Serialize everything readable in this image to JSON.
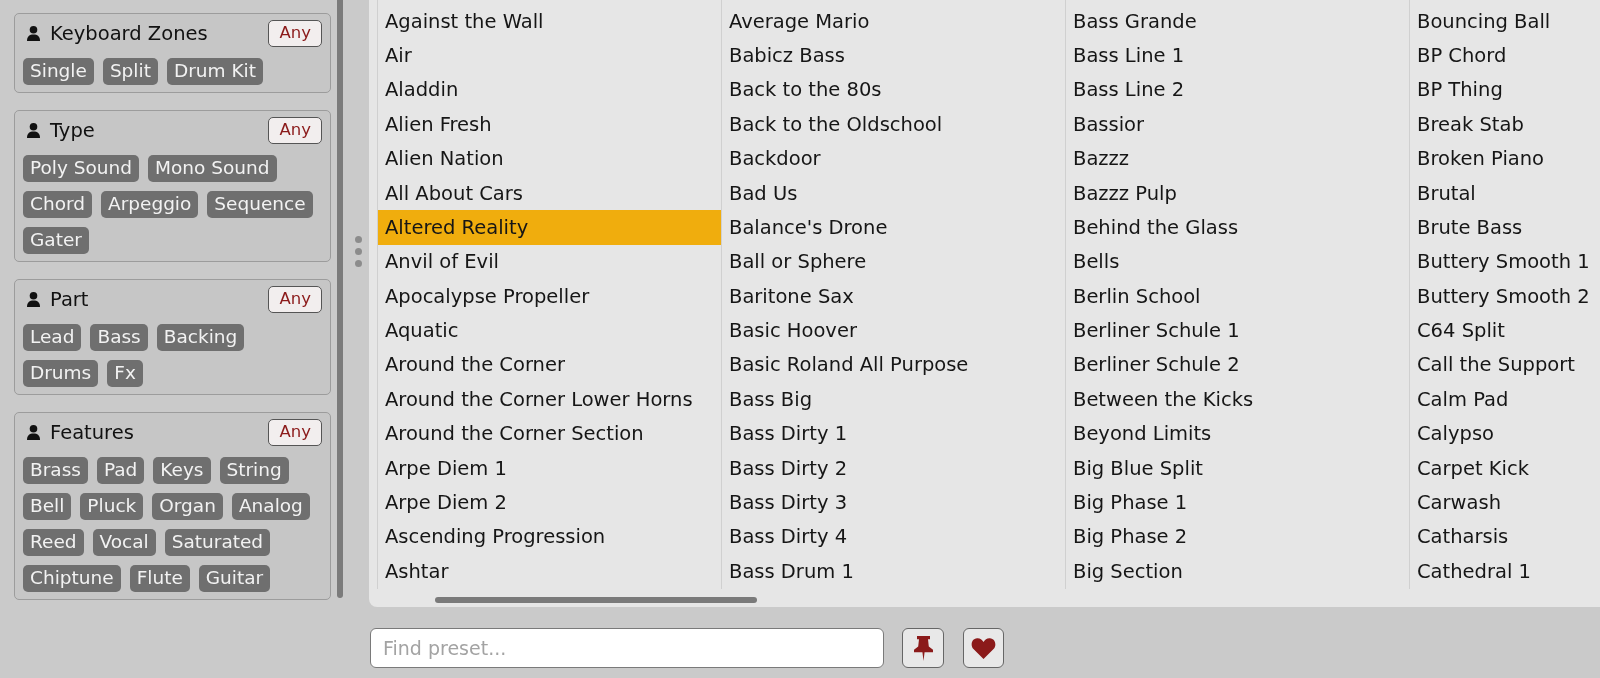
{
  "filters": [
    {
      "title": "Keyboard Zones",
      "any_button": "Any",
      "tags": [
        {
          "label": "Single",
          "selected": false
        },
        {
          "label": "Split",
          "selected": false
        },
        {
          "label": "Drum Kit",
          "selected": false
        }
      ]
    },
    {
      "title": "Type",
      "any_button": "Any",
      "tags": [
        {
          "label": "Poly Sound",
          "selected": false
        },
        {
          "label": "Mono Sound",
          "selected": false
        },
        {
          "label": "Chord",
          "selected": false
        },
        {
          "label": "Arpeggio",
          "selected": false
        },
        {
          "label": "Sequence",
          "selected": false
        },
        {
          "label": "Gater",
          "selected": false
        }
      ]
    },
    {
      "title": "Part",
      "any_button": "Any",
      "tags": [
        {
          "label": "Lead",
          "selected": false
        },
        {
          "label": "Bass",
          "selected": false
        },
        {
          "label": "Backing",
          "selected": false
        },
        {
          "label": "Drums",
          "selected": false
        },
        {
          "label": "Fx",
          "selected": false
        }
      ]
    },
    {
      "title": "Features",
      "any_button": "Any",
      "tags": [
        {
          "label": "Brass",
          "selected": false
        },
        {
          "label": "Pad",
          "selected": false
        },
        {
          "label": "Keys",
          "selected": false
        },
        {
          "label": "String",
          "selected": false
        },
        {
          "label": "Bell",
          "selected": false
        },
        {
          "label": "Pluck",
          "selected": false
        },
        {
          "label": "Organ",
          "selected": false
        },
        {
          "label": "Analog",
          "selected": false
        },
        {
          "label": "Reed",
          "selected": false
        },
        {
          "label": "Vocal",
          "selected": false
        },
        {
          "label": "Saturated",
          "selected": false
        },
        {
          "label": "Chiptune",
          "selected": false
        },
        {
          "label": "Flute",
          "selected": false
        },
        {
          "label": "Guitar",
          "selected": false
        }
      ]
    }
  ],
  "preset_list": {
    "columns": [
      {
        "items": [
          {
            "name": "Against the Wall",
            "selected": false
          },
          {
            "name": "Air",
            "selected": false
          },
          {
            "name": "Aladdin",
            "selected": false
          },
          {
            "name": "Alien Fresh",
            "selected": false
          },
          {
            "name": "Alien Nation",
            "selected": false
          },
          {
            "name": "All About Cars",
            "selected": false
          },
          {
            "name": "Altered Reality",
            "selected": true
          },
          {
            "name": "Anvil of Evil",
            "selected": false
          },
          {
            "name": "Apocalypse Propeller",
            "selected": false
          },
          {
            "name": "Aquatic",
            "selected": false
          },
          {
            "name": "Around the Corner",
            "selected": false
          },
          {
            "name": "Around the Corner Lower Horns",
            "selected": false
          },
          {
            "name": "Around the Corner Section",
            "selected": false
          },
          {
            "name": "Arpe Diem 1",
            "selected": false
          },
          {
            "name": "Arpe Diem 2",
            "selected": false
          },
          {
            "name": "Ascending Progression",
            "selected": false
          },
          {
            "name": "Ashtar",
            "selected": false
          }
        ]
      },
      {
        "items": [
          {
            "name": "Average Mario",
            "selected": false
          },
          {
            "name": "Babicz Bass",
            "selected": false
          },
          {
            "name": "Back to the 80s",
            "selected": false
          },
          {
            "name": "Back to the Oldschool",
            "selected": false
          },
          {
            "name": "Backdoor",
            "selected": false
          },
          {
            "name": "Bad Us",
            "selected": false
          },
          {
            "name": "Balance's Drone",
            "selected": false
          },
          {
            "name": "Ball or Sphere",
            "selected": false
          },
          {
            "name": "Baritone Sax",
            "selected": false
          },
          {
            "name": "Basic Hoover",
            "selected": false
          },
          {
            "name": "Basic Roland All Purpose",
            "selected": false
          },
          {
            "name": "Bass Big",
            "selected": false
          },
          {
            "name": "Bass Dirty 1",
            "selected": false
          },
          {
            "name": "Bass Dirty 2",
            "selected": false
          },
          {
            "name": "Bass Dirty 3",
            "selected": false
          },
          {
            "name": "Bass Dirty 4",
            "selected": false
          },
          {
            "name": "Bass Drum 1",
            "selected": false
          }
        ]
      },
      {
        "items": [
          {
            "name": "Bass Grande",
            "selected": false
          },
          {
            "name": "Bass Line 1",
            "selected": false
          },
          {
            "name": "Bass Line 2",
            "selected": false
          },
          {
            "name": "Bassior",
            "selected": false
          },
          {
            "name": "Bazzz",
            "selected": false
          },
          {
            "name": "Bazzz Pulp",
            "selected": false
          },
          {
            "name": "Behind the Glass",
            "selected": false
          },
          {
            "name": "Bells",
            "selected": false
          },
          {
            "name": "Berlin School",
            "selected": false
          },
          {
            "name": "Berliner Schule 1",
            "selected": false
          },
          {
            "name": "Berliner Schule 2",
            "selected": false
          },
          {
            "name": "Between the Kicks",
            "selected": false
          },
          {
            "name": "Beyond Limits",
            "selected": false
          },
          {
            "name": "Big Blue Split",
            "selected": false
          },
          {
            "name": "Big Phase 1",
            "selected": false
          },
          {
            "name": "Big Phase 2",
            "selected": false
          },
          {
            "name": "Big Section",
            "selected": false
          }
        ]
      },
      {
        "items": [
          {
            "name": "Bouncing Ball",
            "selected": false
          },
          {
            "name": "BP Chord",
            "selected": false
          },
          {
            "name": "BP Thing",
            "selected": false
          },
          {
            "name": "Break Stab",
            "selected": false
          },
          {
            "name": "Broken Piano",
            "selected": false
          },
          {
            "name": "Brutal",
            "selected": false
          },
          {
            "name": "Brute Bass",
            "selected": false
          },
          {
            "name": "Buttery Smooth 1",
            "selected": false
          },
          {
            "name": "Buttery Smooth 2",
            "selected": false
          },
          {
            "name": "C64 Split",
            "selected": false
          },
          {
            "name": "Call the Support",
            "selected": false
          },
          {
            "name": "Calm Pad",
            "selected": false
          },
          {
            "name": "Calypso",
            "selected": false
          },
          {
            "name": "Carpet Kick",
            "selected": false
          },
          {
            "name": "Carwash",
            "selected": false
          },
          {
            "name": "Catharsis",
            "selected": false
          },
          {
            "name": "Cathedral 1",
            "selected": false
          }
        ]
      }
    ]
  },
  "search": {
    "placeholder": "Find preset..."
  }
}
